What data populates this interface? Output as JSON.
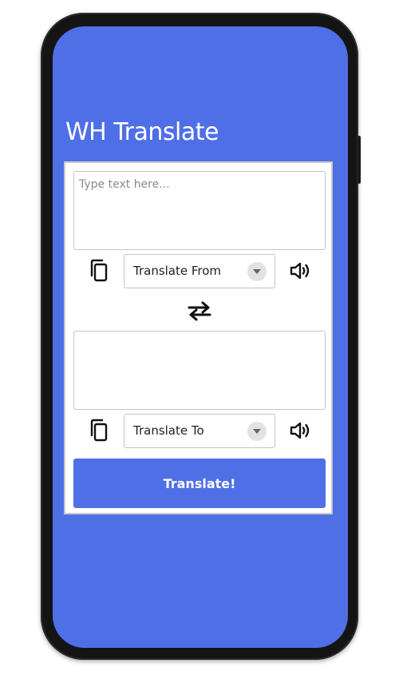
{
  "app": {
    "title": "WH Translate"
  },
  "source": {
    "placeholder": "Type text here...",
    "value": "",
    "language_label": "Translate From",
    "copy_icon": "copy-icon",
    "speak_icon": "speaker-icon"
  },
  "swap": {
    "icon": "swap-arrows-icon"
  },
  "target": {
    "placeholder": "",
    "value": "",
    "language_label": "Translate To",
    "copy_icon": "copy-icon",
    "speak_icon": "speaker-icon"
  },
  "actions": {
    "translate_label": "Translate!"
  },
  "colors": {
    "accent": "#4f6fe6",
    "phone_frame": "#141414",
    "card_border": "#c9c9c9",
    "text_white": "#ffffff"
  }
}
